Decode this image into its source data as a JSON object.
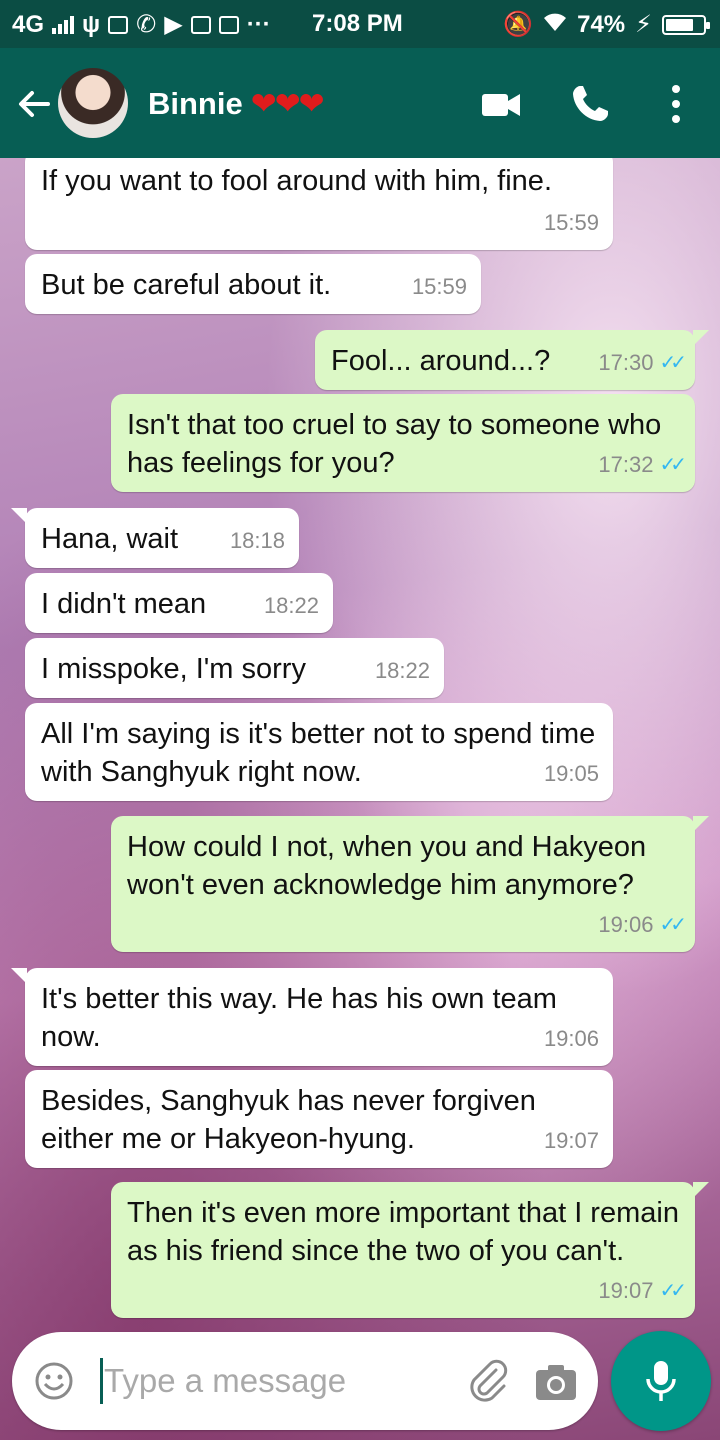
{
  "status_bar": {
    "network": "4G",
    "time": "7:08 PM",
    "battery": "74%",
    "battery_level": 0.74,
    "icons": [
      "signal-icon",
      "usb-icon",
      "vk-icon",
      "phone-icon",
      "youtube-icon",
      "instagram-icon",
      "facebook-icon",
      "more-dots-icon",
      "mute-icon",
      "wifi-icon",
      "charging-icon",
      "battery-icon"
    ]
  },
  "header": {
    "contact_name": "Binnie",
    "hearts": "❤❤❤",
    "icons": [
      "back-arrow-icon",
      "video-call-icon",
      "voice-call-icon",
      "menu-dots-icon"
    ]
  },
  "messages": [
    {
      "dir": "in",
      "text": "If you want to fool around with him, fine.",
      "time": "15:59"
    },
    {
      "dir": "in",
      "text": "But be careful about it.",
      "time": "15:59"
    },
    {
      "dir": "out",
      "text": "Fool... around...?",
      "time": "17:30"
    },
    {
      "dir": "out",
      "text": "Isn't that too cruel to say to someone who has feelings for you?",
      "time": "17:32"
    },
    {
      "dir": "in",
      "text": "Hana, wait",
      "time": "18:18"
    },
    {
      "dir": "in",
      "text": "I didn't mean",
      "time": "18:22"
    },
    {
      "dir": "in",
      "text": "I misspoke, I'm sorry",
      "time": "18:22"
    },
    {
      "dir": "in",
      "text": "All I'm saying is it's better not to spend time with Sanghyuk right now.",
      "time": "19:05"
    },
    {
      "dir": "out",
      "text": "How could I not, when you and Hakyeon won't even acknowledge him anymore?",
      "time": "19:06"
    },
    {
      "dir": "in",
      "text": "It's better this way. He has his own team now.",
      "time": "19:06"
    },
    {
      "dir": "in",
      "text": "Besides, Sanghyuk has never forgiven either me or Hakyeon-hyung.",
      "time": "19:07"
    },
    {
      "dir": "out",
      "text": "Then it's even more important that I remain as his friend since the two of you can't.",
      "time": "19:07"
    }
  ],
  "input": {
    "placeholder": "Type a message",
    "icons": [
      "emoji-icon",
      "attach-icon",
      "camera-icon",
      "mic-icon"
    ]
  },
  "colors": {
    "header": "#075e54",
    "status_bar": "#0b4d44",
    "outgoing_bubble": "#dcf8c6",
    "incoming_bubble": "#ffffff",
    "read_ticks": "#34b7f1",
    "mic_button": "#009688"
  }
}
